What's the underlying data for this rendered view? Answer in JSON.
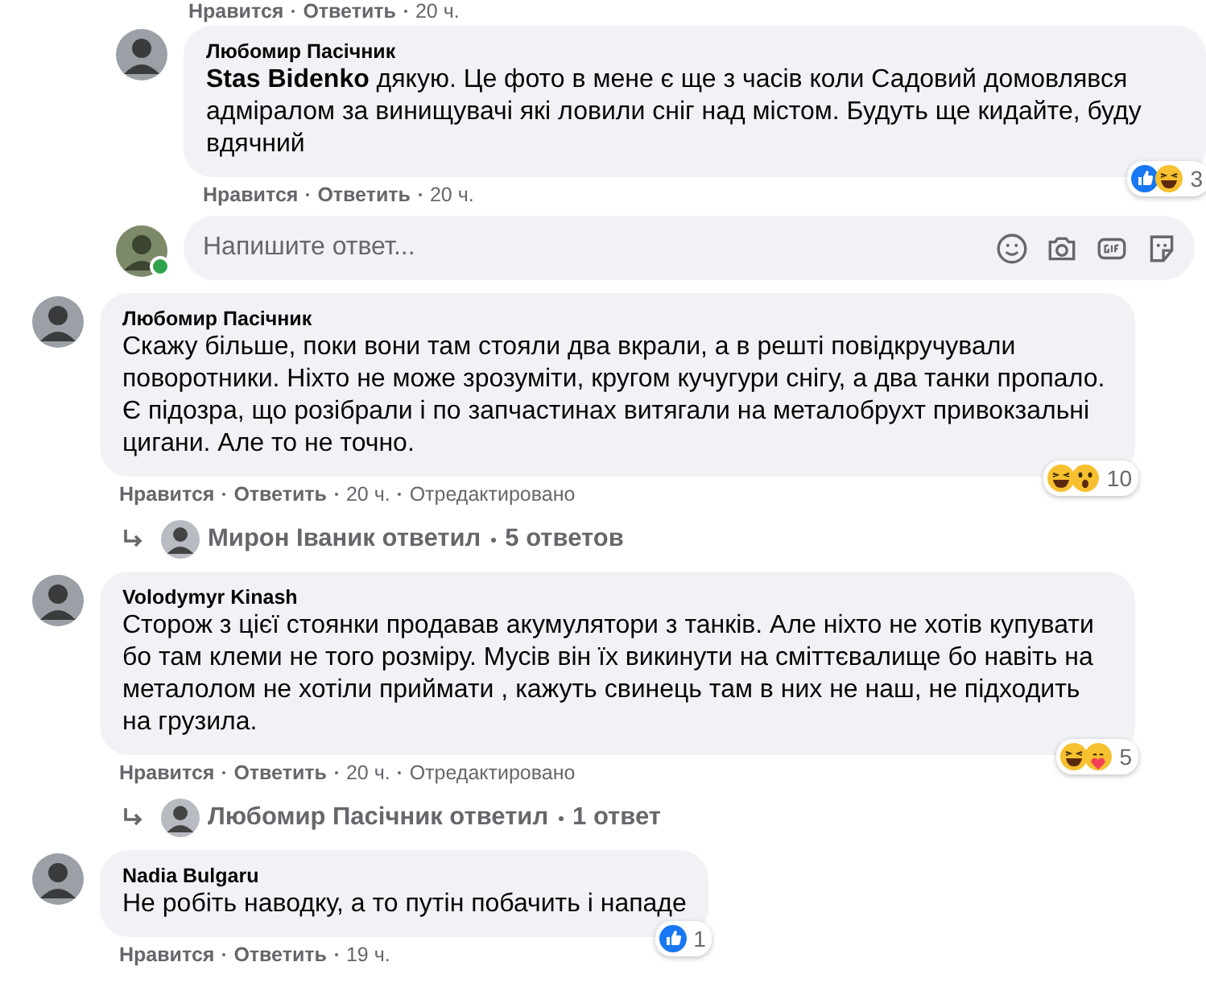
{
  "top_actions": {
    "like": "Нравится",
    "reply": "Ответить",
    "time": "20 ч."
  },
  "items": [
    {
      "kind": "comment",
      "nested": true,
      "author": "Любомир Пасічник",
      "text": "**Stas Bidenko** дякую. Це фото в мене є ще з часів коли Садовий домовлявся адміралом за винищувачі які ловили сніг над містом. Будуть ще кидайте, буду вдячний",
      "reactions": [
        {
          "kind": "like"
        },
        {
          "kind": "haha"
        }
      ],
      "reaction_count": "3",
      "like": "Нравится",
      "reply": "Ответить",
      "time": "20 ч."
    },
    {
      "kind": "composer",
      "nested": true,
      "placeholder": "Напишите ответ...",
      "online": true
    },
    {
      "kind": "comment",
      "nested": false,
      "author": "Любомир Пасічник",
      "text": "Скажу більше, поки вони там стояли два вкрали, а в решті повідкручували поворотники. Ніхто не може зрозуміти, кругом кучугури снігу, а два танки пропало. Є підозра, що розібрали і по запчастинах витягали на металобрухт привокзальні цигани. Але то не точно.",
      "reactions": [
        {
          "kind": "haha"
        },
        {
          "kind": "wow"
        }
      ],
      "reaction_count": "10",
      "like": "Нравится",
      "reply": "Ответить",
      "time": "20 ч.",
      "edited": "Отредактировано"
    },
    {
      "kind": "replies",
      "who": "Мирон Іваник ответил",
      "count": "5 ответов"
    },
    {
      "kind": "comment",
      "nested": false,
      "author": "Volodymyr Kinash",
      "text": "Сторож з цієї стоянки продавав акумулятори з танків. Але ніхто не хотів купувати бо там клеми не того розміру. Мусів він їх викинути на сміттєвалище бо навіть на металолом не хотіли приймати , кажуть свинець там в них не наш, не підходить на грузила.",
      "reactions": [
        {
          "kind": "haha"
        },
        {
          "kind": "care"
        }
      ],
      "reaction_count": "5",
      "like": "Нравится",
      "reply": "Ответить",
      "time": "20 ч.",
      "edited": "Отредактировано"
    },
    {
      "kind": "replies",
      "who": "Любомир Пасічник ответил",
      "count": "1 ответ"
    },
    {
      "kind": "comment",
      "nested": false,
      "author": "Nadia Bulgaru",
      "text": "Не робіть наводку, а то путін побачить і нападе",
      "reactions": [
        {
          "kind": "like"
        }
      ],
      "reaction_count": "1",
      "like": "Нравится",
      "reply": "Ответить",
      "time": "19 ч."
    }
  ]
}
